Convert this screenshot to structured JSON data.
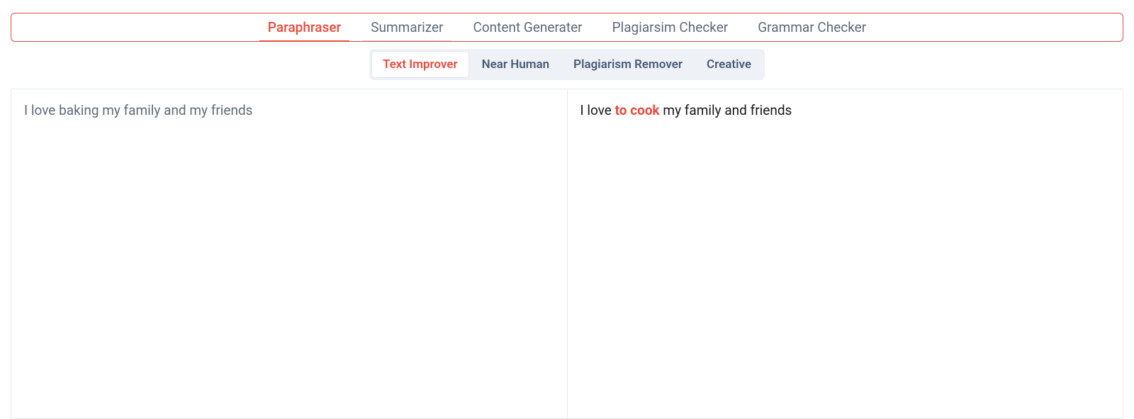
{
  "mainTabs": {
    "paraphraser": "Paraphraser",
    "summarizer": "Summarizer",
    "contentGenerator": "Content Generater",
    "plagiarismChecker": "Plagiarsim Checker",
    "grammarChecker": "Grammar Checker"
  },
  "subTabs": {
    "textImprover": "Text Improver",
    "nearHuman": "Near Human",
    "plagiarismRemover": "Plagiarism Remover",
    "creative": "Creative"
  },
  "input": {
    "text": "I love baking my family and my friends"
  },
  "output": {
    "prefix": "I love ",
    "highlight": "to cook",
    "suffix": " my family and friends"
  }
}
